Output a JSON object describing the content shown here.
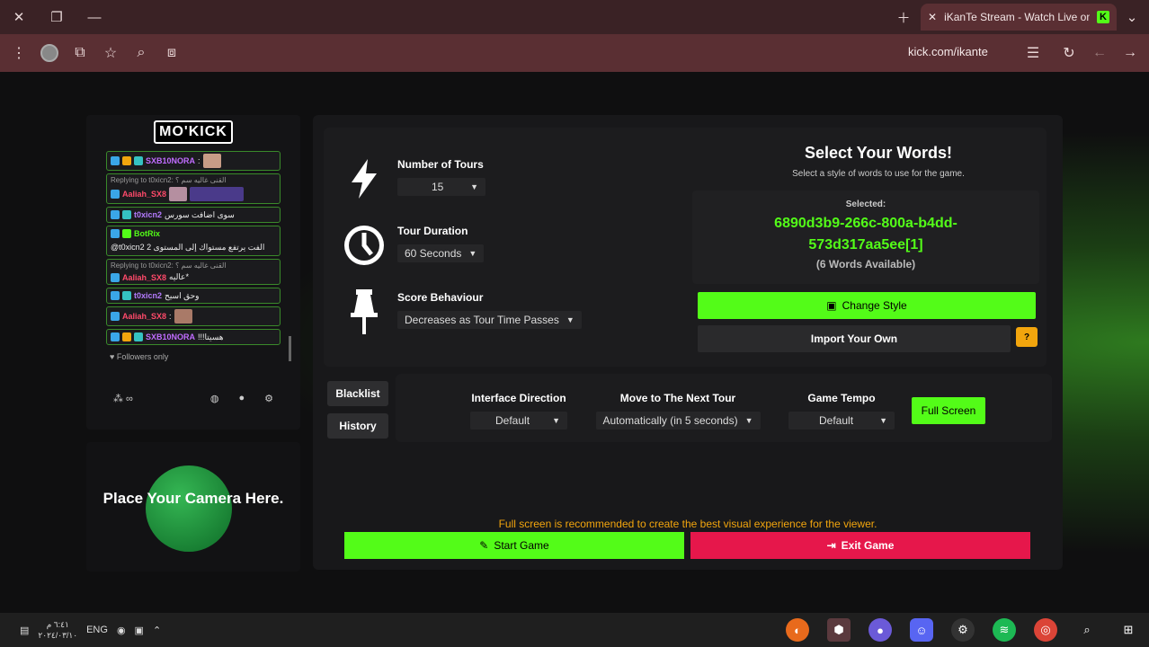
{
  "browser": {
    "tab_title": "iKanTe Stream - Watch Live on",
    "url": "kick.com/ikante"
  },
  "chat": {
    "logo": "MO'KICK",
    "messages": [
      {
        "user": "SXB10NORA",
        "text": ":",
        "reply": ""
      },
      {
        "user": "Aaliah_SX8",
        "text": "",
        "reply": "Replying to t0xicn2: القنى غاليه سم ؟"
      },
      {
        "user": "t0xicn2",
        "text": "سوى اضافت سورس",
        "reply": ""
      },
      {
        "user": "BotRix",
        "text": "@t0xicn2 الفت يرتفع مستواك إلى المستوى 2",
        "reply": ""
      },
      {
        "user": "Aaliah_SX8",
        "text": "عاليه*",
        "reply": "Replying to t0xicn2: القنى غاليه سم ؟"
      },
      {
        "user": "t0xicn2",
        "text": "وحق اسيح",
        "reply": ""
      },
      {
        "user": "Aaliah_SX8",
        "text": ":",
        "reply": ""
      },
      {
        "user": "SXB10NORA",
        "text": "!!!هسيتا",
        "reply": ""
      }
    ],
    "followers_only": "Followers only",
    "icons": [
      "users-icon",
      "emote-icon",
      "chat-icon",
      "gear-icon"
    ]
  },
  "camera": {
    "text": "Place Your Camera Here."
  },
  "settings": {
    "tours_label": "Number of Tours",
    "tours_value": "15",
    "duration_label": "Tour Duration",
    "duration_value": "60 Seconds",
    "score_label": "Score Behaviour",
    "score_value": "Decreases as Tour Time Passes"
  },
  "words": {
    "title": "Select Your Words!",
    "subtitle": "Select a style of words to use for the game.",
    "selected_label": "Selected:",
    "selected_id_line1": "6890d3b9-266c-800a-b4dd-",
    "selected_id_line2": "573d317aa5ee[1]",
    "available": "(6 Words Available)",
    "change_style": "Change Style",
    "import_own": "Import Your Own",
    "help": "?"
  },
  "side": {
    "blacklist": "Blacklist",
    "history": "History"
  },
  "options": {
    "direction_label": "Interface Direction",
    "direction_value": "Default",
    "next_tour_label": "Move to The Next Tour",
    "next_tour_value": "Automatically (in 5 seconds)",
    "tempo_label": "Game Tempo",
    "tempo_value": "Default",
    "full_screen": "Full Screen"
  },
  "footer": {
    "note": "Full screen is recommended to create the best visual experience for the viewer.",
    "start": "Start Game",
    "exit": "Exit Game"
  },
  "taskbar": {
    "lang": "ENG",
    "time": "٦:٤١ م",
    "date": "٢٠٢٤/٠٣/١٠"
  },
  "colors": {
    "accent_green": "#53fc18",
    "danger_red": "#e6174b",
    "warning_orange": "#f2a50d"
  }
}
